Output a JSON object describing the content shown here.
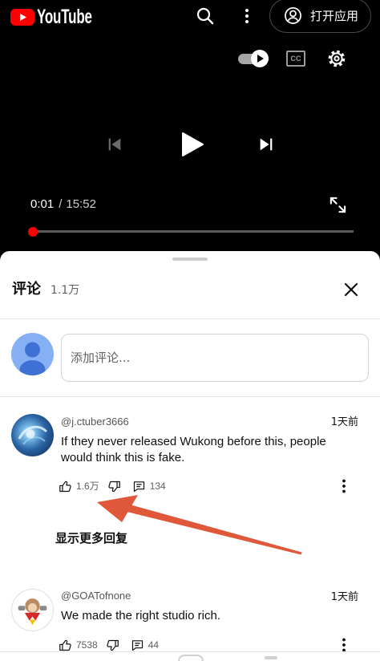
{
  "top_bar": {
    "logo_text": "YouTube",
    "open_app_label": "打开应用",
    "icons": [
      "youtube-logo-icon",
      "search-icon",
      "more-vert-icon",
      "account-icon"
    ]
  },
  "player": {
    "autoplay_on": true,
    "cc_label": "CC",
    "current_time": "0:01",
    "time_separator": "/",
    "duration": "15:52",
    "progress_fraction": 0.001,
    "controls_icons": [
      "autoplay-toggle-icon",
      "captions-icon",
      "gear-icon",
      "previous-icon",
      "play-icon",
      "next-icon",
      "fullscreen-icon"
    ]
  },
  "comments_panel": {
    "title": "评论",
    "count": "1.1万",
    "composer": {
      "placeholder": "添加评论..."
    },
    "comments": [
      {
        "author": "@j.ctuber3666",
        "time_ago": "1天前",
        "text": "If they never released Wukong before this, people would think this is fake.",
        "likes": "1.6万",
        "replies": "134",
        "show_more_replies_label": "显示更多回复"
      },
      {
        "author": "@GOATofnone",
        "time_ago": "1天前",
        "text": "We made the right studio rich.",
        "likes": "7538",
        "replies": "44"
      }
    ],
    "action_icons": [
      "thumb-up-icon",
      "thumb-down-icon",
      "reply-icon",
      "more-vert-icon",
      "close-icon"
    ]
  },
  "colors": {
    "brand_red": "#ff0000",
    "progress_red": "#ff0000",
    "annotation_arrow": "#e0583a",
    "text_primary": "#0f0f0f",
    "text_secondary": "#606060",
    "player_bg": "#000000"
  }
}
